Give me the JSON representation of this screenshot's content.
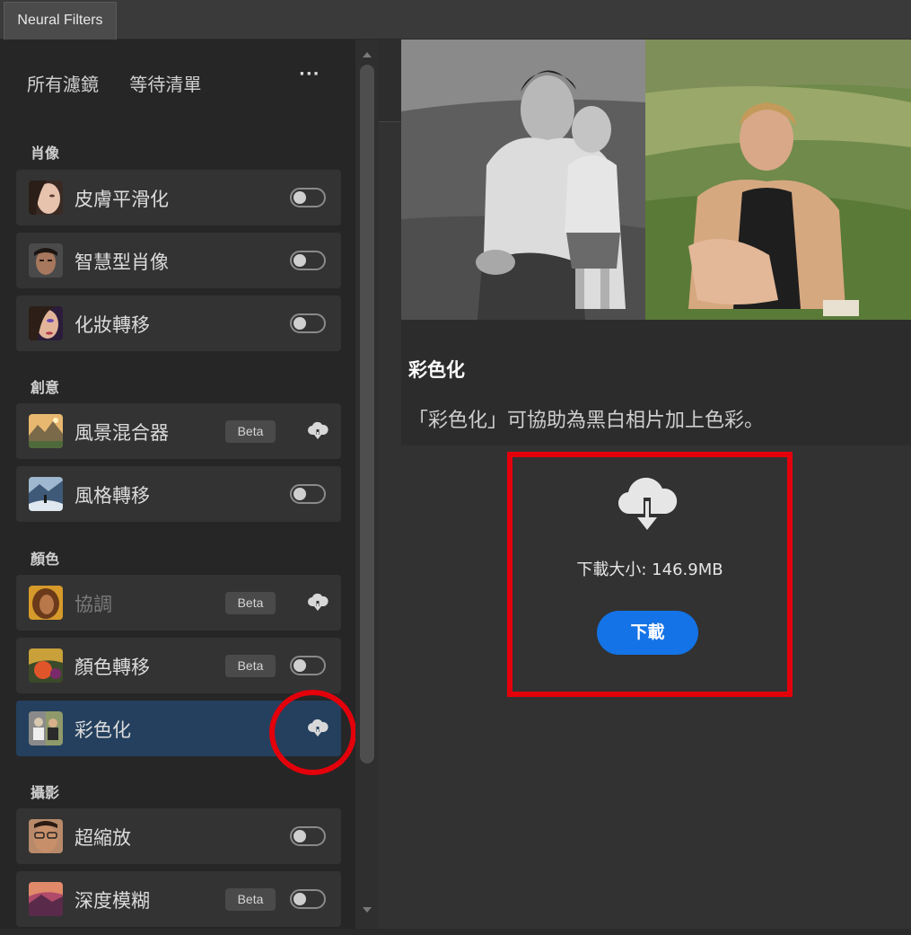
{
  "window": {
    "tab_label": "Neural Filters"
  },
  "nav": {
    "all_filters": "所有濾鏡",
    "waitlist": "等待清單",
    "more": "···"
  },
  "sections": {
    "portrait": "肖像",
    "creative": "創意",
    "color": "顏色",
    "photography": "攝影"
  },
  "filters": [
    {
      "label": "皮膚平滑化",
      "status": "toggle-off"
    },
    {
      "label": "智慧型肖像",
      "status": "toggle-off"
    },
    {
      "label": "化妝轉移",
      "status": "toggle-off"
    },
    {
      "label": "風景混合器",
      "badge": "Beta",
      "status": "download"
    },
    {
      "label": "風格轉移",
      "status": "toggle-off"
    },
    {
      "label": "協調",
      "badge": "Beta",
      "status": "download",
      "dimmed": true
    },
    {
      "label": "顏色轉移",
      "badge": "Beta",
      "status": "toggle-off"
    },
    {
      "label": "彩色化",
      "status": "download",
      "selected": true
    },
    {
      "label": "超縮放",
      "status": "toggle-off"
    },
    {
      "label": "深度模糊",
      "badge": "Beta",
      "status": "toggle-off"
    }
  ],
  "detail": {
    "title": "彩色化",
    "description": "「彩色化」可協助為黑白相片加上色彩。",
    "download_size": "下載大小: 146.9MB",
    "download_button": "下載"
  },
  "colors": {
    "selected_bg": "#25405e",
    "accent_blue": "#1473e6",
    "annotation_red": "#e3000b"
  }
}
